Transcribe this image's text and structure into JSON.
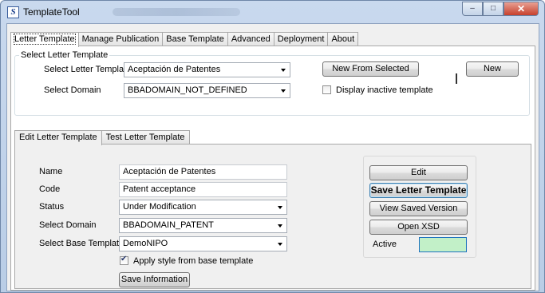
{
  "window": {
    "title": "TemplateTool",
    "app_icon_glyph": "S",
    "minimize_glyph": "–",
    "maximize_glyph": "□",
    "close_glyph": "✕"
  },
  "tabs": [
    "Letter Template",
    "Manage Publication",
    "Base Template",
    "Advanced",
    "Deployment",
    "About"
  ],
  "select_group": {
    "title": "Select Letter Template",
    "letter_template_label": "Select Letter Template",
    "letter_template_value": "Aceptación de Patentes",
    "domain_label": "Select Domain",
    "domain_value": "BBADOMAIN_NOT_DEFINED",
    "new_from_selected": "New From Selected",
    "new": "New",
    "display_inactive": "Display inactive template",
    "display_inactive_checked": false
  },
  "subtabs": [
    "Edit Letter Template",
    "Test Letter Template"
  ],
  "form": {
    "name_label": "Name",
    "name_value": "Aceptación de Patentes",
    "code_label": "Code",
    "code_value": "Patent acceptance",
    "status_label": "Status",
    "status_value": "Under Modification",
    "domain_label": "Select Domain",
    "domain_value": "BBADOMAIN_PATENT",
    "base_template_label": "Select Base Template",
    "base_template_value": "DemoNIPO",
    "apply_style": "Apply style from base template",
    "apply_style_checked": true,
    "save_info": "Save Information"
  },
  "actions": {
    "edit": "Edit",
    "save_letter_template": "Save Letter Template",
    "view_saved_version": "View Saved Version",
    "open_xsd": "Open XSD",
    "active_label": "Active",
    "active_color": "#c2f0c8"
  }
}
